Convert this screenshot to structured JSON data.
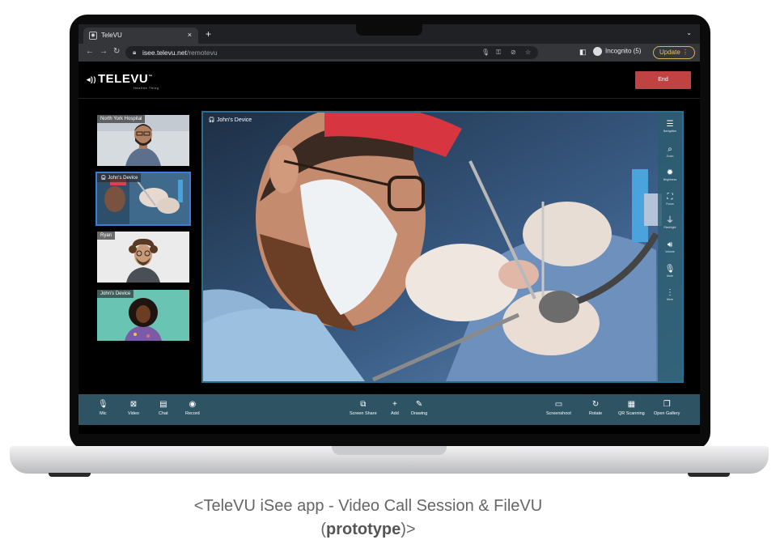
{
  "browser": {
    "tab_title": "TeleVU",
    "tab_close": "×",
    "new_tab": "+",
    "tab_menu": "⌄",
    "url_host": "isee.televu.net",
    "url_path": "/remotevu",
    "incognito_label": "Incognito (5)",
    "update_label": "Update  ⋮"
  },
  "app": {
    "logo": "TELEVU",
    "logo_tagline": "Healthe Thing",
    "end_label": "End"
  },
  "participants": [
    {
      "label": "North York Hospital"
    },
    {
      "label": "John's Device"
    },
    {
      "label": "Ryan"
    },
    {
      "label": "John's Device"
    }
  ],
  "main_video": {
    "label": "John's Device"
  },
  "side_tools": [
    {
      "label": "Navigation",
      "icon": "menu-icon"
    },
    {
      "label": "Zoom",
      "icon": "zoom-icon"
    },
    {
      "label": "Brightness",
      "icon": "brightness-icon"
    },
    {
      "label": "Focus",
      "icon": "focus-icon"
    },
    {
      "label": "Flashlight",
      "icon": "flashlight-icon"
    },
    {
      "label": "Volume",
      "icon": "volume-icon"
    },
    {
      "label": "Mute",
      "icon": "mute-icon"
    },
    {
      "label": "More",
      "icon": "more-icon"
    }
  ],
  "toolbar": {
    "mic": "Mic",
    "video": "Video",
    "chat": "Chat",
    "record": "Record",
    "screen_share": "Screen Share",
    "add": "Add",
    "drawing": "Drawing",
    "screenshoot": "Screenshoot",
    "rotate": "Rotate",
    "qr_scanning": "QR Scanning",
    "open_gallery": "Open Gallery"
  },
  "caption": {
    "line1": "<TeleVU iSee app - Video Call Session & FileVU",
    "line2_open": "(",
    "line2_bold": "prototype",
    "line2_close": ")>"
  },
  "colors": {
    "end_button": "#c04242",
    "toolbar": "#2e5362",
    "video_border": "#2c6d8c"
  }
}
